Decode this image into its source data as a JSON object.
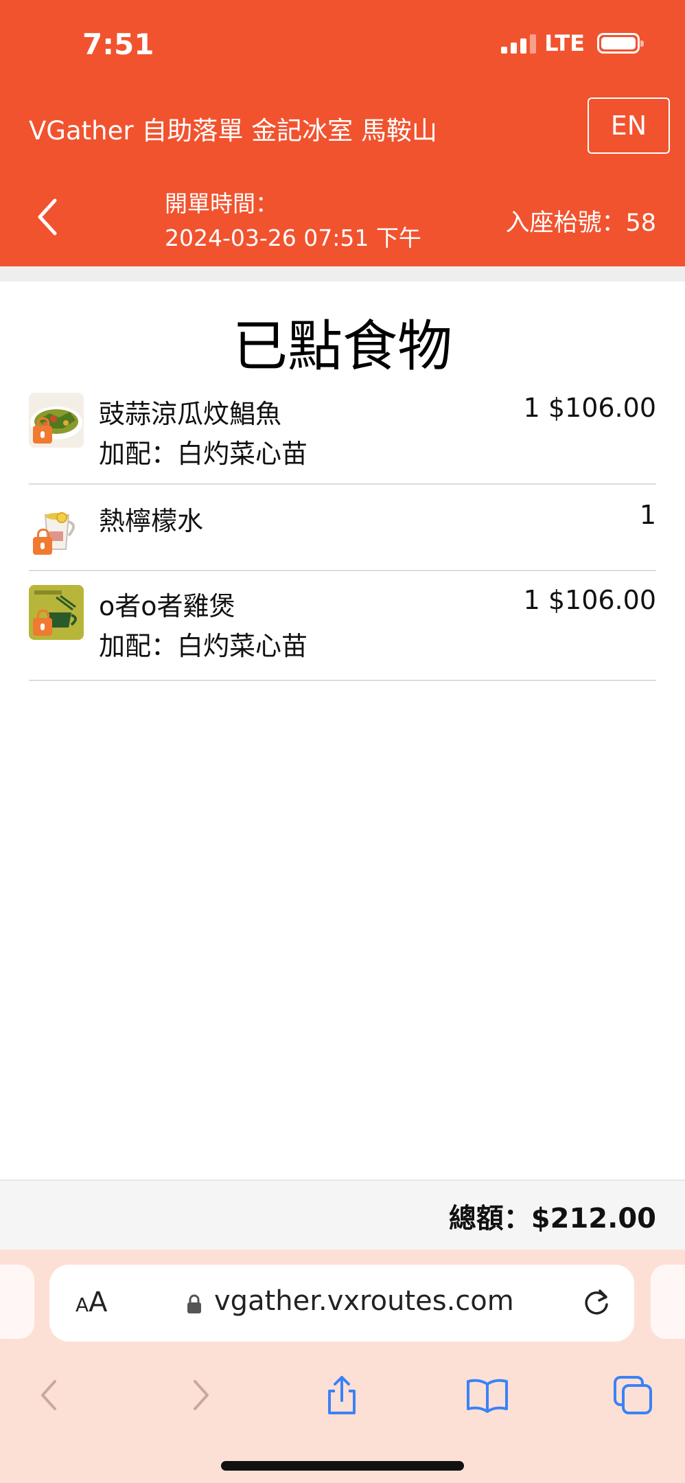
{
  "status_bar": {
    "time": "7:51",
    "network": "LTE"
  },
  "header": {
    "store_name": "VGather 自助落單 金記冰室 馬鞍山",
    "language_button": "EN",
    "open_time_label": "開單時間：",
    "open_time_value": "2024-03-26 07:51 下午",
    "table_number": "入座枱號：58"
  },
  "main": {
    "title": "已點食物",
    "items": [
      {
        "name": "豉蒜涼瓜炆鯧魚",
        "addon": "加配：白灼菜心苗",
        "qty_price": "1 $106.00",
        "thumb_icon": "dish-photo-icon"
      },
      {
        "name": "熱檸檬水",
        "addon": "",
        "qty_price": "1",
        "thumb_icon": "lemon-tea-photo-icon"
      },
      {
        "name": "o者o者雞煲",
        "addon": "加配：白灼菜心苗",
        "qty_price": "1 $106.00",
        "thumb_icon": "restaurant-logo-icon"
      }
    ],
    "total": "總額：$212.00"
  },
  "browser": {
    "text_size_label": "AA",
    "url": "vgather.vxroutes.com"
  },
  "colors": {
    "brand": "#f1532f",
    "browser_bg": "#fde0d5",
    "accent_blue": "#3a82f7"
  }
}
